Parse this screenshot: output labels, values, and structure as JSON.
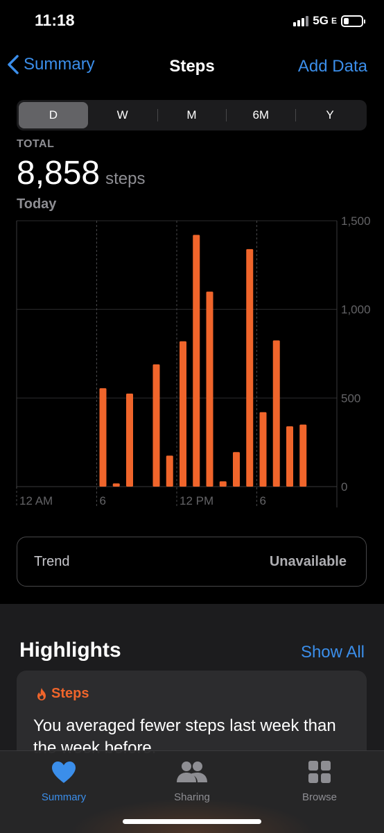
{
  "status": {
    "time": "11:18",
    "network": "5G",
    "network_suffix": "E"
  },
  "nav": {
    "back_label": "Summary",
    "title": "Steps",
    "action_label": "Add Data"
  },
  "segments": [
    {
      "label": "D",
      "active": true
    },
    {
      "label": "W",
      "active": false
    },
    {
      "label": "M",
      "active": false
    },
    {
      "label": "6M",
      "active": false
    },
    {
      "label": "Y",
      "active": false
    }
  ],
  "total": {
    "label": "TOTAL",
    "value": "8,858",
    "unit": "steps",
    "period": "Today"
  },
  "chart_data": {
    "type": "bar",
    "x_tick_labels": [
      "12 AM",
      "6",
      "12 PM",
      "6"
    ],
    "y_tick_labels": [
      "1,500",
      "1,000",
      "500",
      "0"
    ],
    "ylim": [
      0,
      1500
    ],
    "hour_values": [
      {
        "hour": 6.0,
        "value": 555
      },
      {
        "hour": 7.0,
        "value": 18
      },
      {
        "hour": 8.0,
        "value": 525
      },
      {
        "hour": 10.0,
        "value": 690
      },
      {
        "hour": 11.0,
        "value": 175
      },
      {
        "hour": 12.0,
        "value": 820
      },
      {
        "hour": 13.0,
        "value": 1420
      },
      {
        "hour": 14.0,
        "value": 1100
      },
      {
        "hour": 15.0,
        "value": 30
      },
      {
        "hour": 16.0,
        "value": 195
      },
      {
        "hour": 17.0,
        "value": 1340
      },
      {
        "hour": 18.0,
        "value": 420
      },
      {
        "hour": 19.0,
        "value": 825
      },
      {
        "hour": 20.0,
        "value": 340
      },
      {
        "hour": 21.0,
        "value": 350
      }
    ],
    "bar_color": "#f0652b",
    "grid": true
  },
  "trend": {
    "label": "Trend",
    "value": "Unavailable"
  },
  "highlights": {
    "title": "Highlights",
    "show_all": "Show All",
    "card_title": "Steps",
    "card_text": "You averaged fewer steps last week than the week before."
  },
  "tabs": [
    {
      "label": "Summary",
      "icon": "heart-icon",
      "active": true
    },
    {
      "label": "Sharing",
      "icon": "people-icon",
      "active": false
    },
    {
      "label": "Browse",
      "icon": "grid-icon",
      "active": false
    }
  ],
  "colors": {
    "accent": "#3b8eea",
    "steps": "#f0652b"
  }
}
